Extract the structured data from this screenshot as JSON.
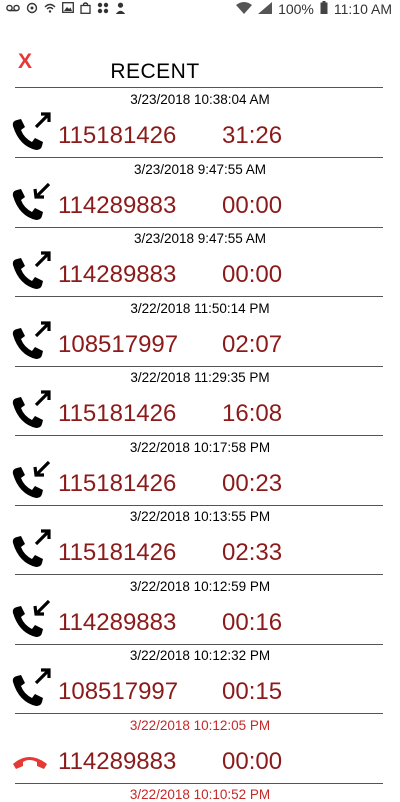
{
  "status": {
    "battery": "100%",
    "time": "11:10 AM"
  },
  "header": {
    "close_label": "X",
    "title": "RECENT"
  },
  "calls": [
    {
      "date": "3/23/2018 10:38:04 AM",
      "number": "115181426",
      "duration": "31:26",
      "type": "outgoing"
    },
    {
      "date": "3/23/2018 9:47:55 AM",
      "number": "114289883",
      "duration": "00:00",
      "type": "incoming"
    },
    {
      "date": "3/23/2018 9:47:55 AM",
      "number": "114289883",
      "duration": "00:00",
      "type": "outgoing"
    },
    {
      "date": "3/22/2018 11:50:14 PM",
      "number": "108517997",
      "duration": "02:07",
      "type": "outgoing"
    },
    {
      "date": "3/22/2018 11:29:35 PM",
      "number": "115181426",
      "duration": "16:08",
      "type": "outgoing"
    },
    {
      "date": "3/22/2018 10:17:58 PM",
      "number": "115181426",
      "duration": "00:23",
      "type": "incoming"
    },
    {
      "date": "3/22/2018 10:13:55 PM",
      "number": "115181426",
      "duration": "02:33",
      "type": "outgoing"
    },
    {
      "date": "3/22/2018 10:12:59 PM",
      "number": "114289883",
      "duration": "00:16",
      "type": "incoming"
    },
    {
      "date": "3/22/2018 10:12:32 PM",
      "number": "108517997",
      "duration": "00:15",
      "type": "outgoing"
    },
    {
      "date": "3/22/2018 10:12:05 PM",
      "number": "114289883",
      "duration": "00:00",
      "type": "missed"
    }
  ],
  "trailing_date": "3/22/2018 10:10:52 PM",
  "colors": {
    "accent_red": "#e53935",
    "number_color": "#8b1a1a",
    "missed_date_color": "#c62828"
  }
}
